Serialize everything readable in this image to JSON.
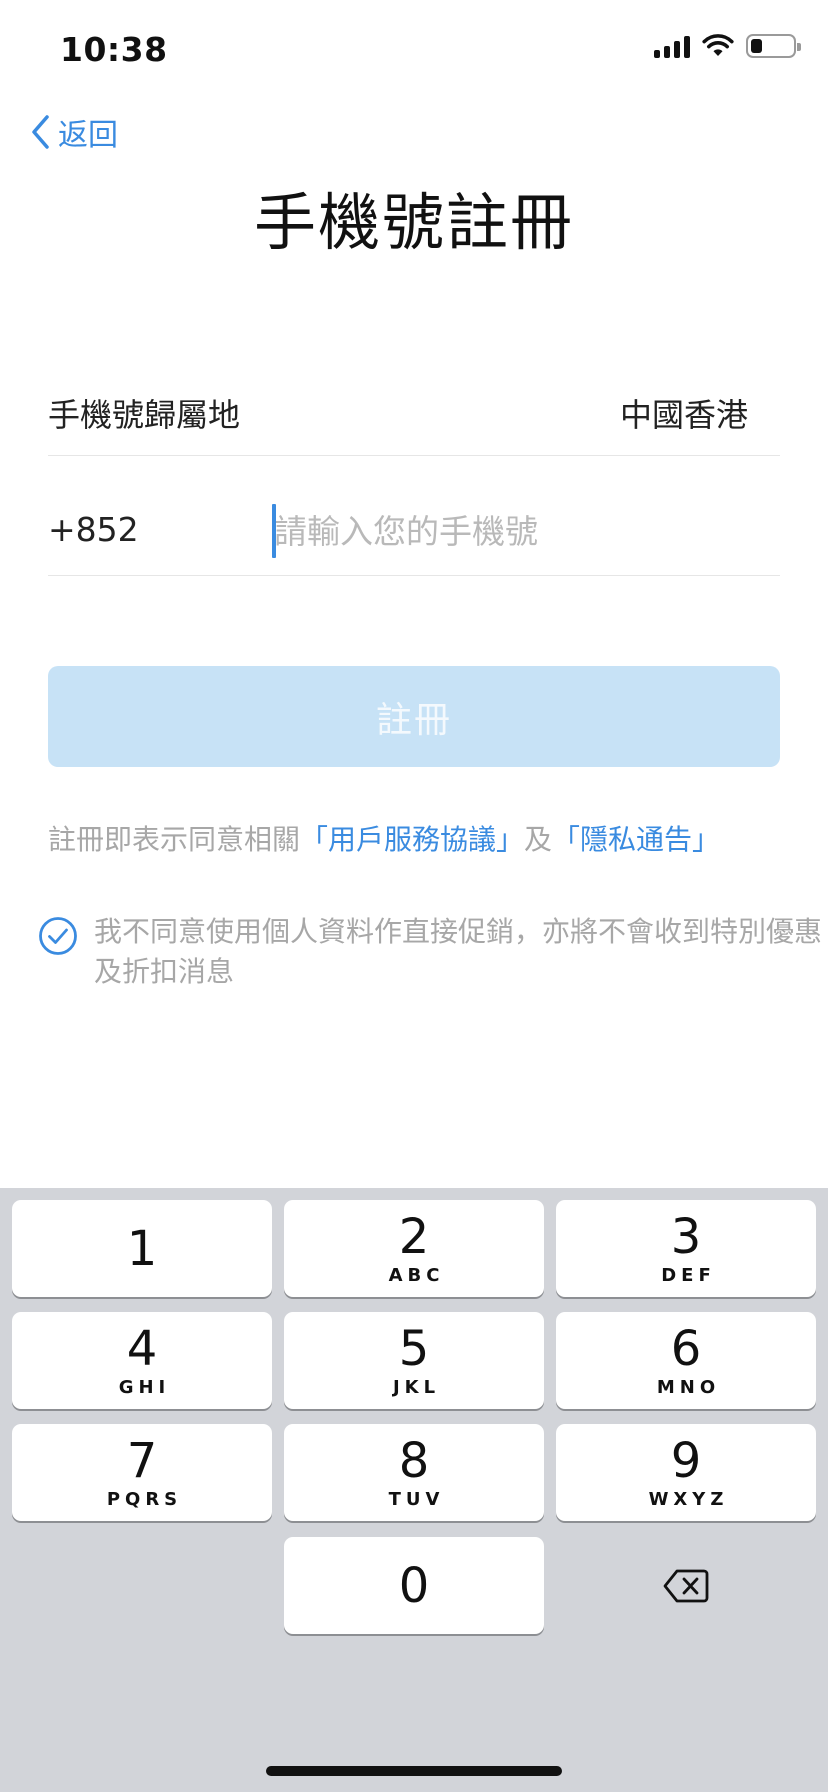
{
  "status_bar": {
    "time": "10:38"
  },
  "nav": {
    "back_label": "返回"
  },
  "page": {
    "title": "手機號註冊"
  },
  "form": {
    "region_label": "手機號歸屬地",
    "region_value": "中國香港",
    "phone_code": "+852",
    "phone_value": "",
    "phone_placeholder": "請輸入您的手機號"
  },
  "register_button": {
    "label": "註冊"
  },
  "agreement": {
    "prefix": "註冊即表示同意相關",
    "terms_link": "「用戶服務協議」",
    "joiner": "及",
    "privacy_link": "「隱私通告」"
  },
  "consent": {
    "checked": true,
    "text": "我不同意使用個人資料作直接促銷，亦將不會收到特別優惠及折扣消息"
  },
  "keypad": {
    "keys": [
      {
        "digit": "1",
        "letters": ""
      },
      {
        "digit": "2",
        "letters": "ABC"
      },
      {
        "digit": "3",
        "letters": "DEF"
      },
      {
        "digit": "4",
        "letters": "GHI"
      },
      {
        "digit": "5",
        "letters": "JKL"
      },
      {
        "digit": "6",
        "letters": "MNO"
      },
      {
        "digit": "7",
        "letters": "PQRS"
      },
      {
        "digit": "8",
        "letters": "TUV"
      },
      {
        "digit": "9",
        "letters": "WXYZ"
      },
      {
        "digit": "0",
        "letters": ""
      }
    ],
    "delete_icon": "backspace-icon"
  },
  "colors": {
    "accent": "#3a8be0",
    "button_disabled_bg": "#c7e2f6",
    "keyboard_bg": "#d2d4d9",
    "muted_text": "#a7a7a7"
  }
}
